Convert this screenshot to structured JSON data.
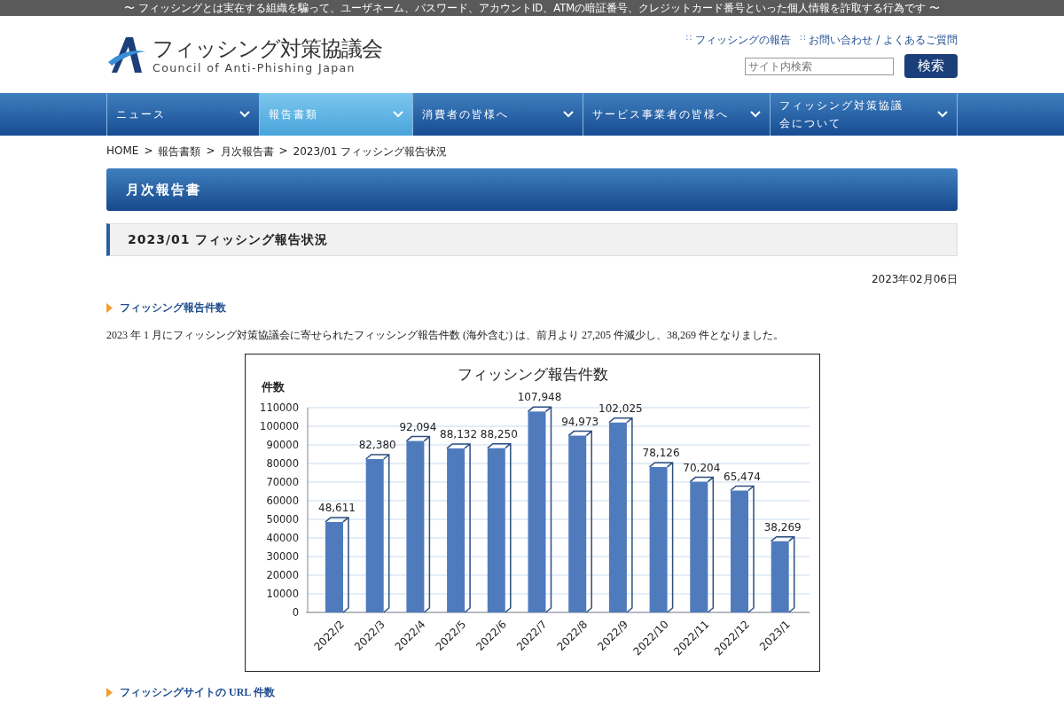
{
  "top_banner": "〜 フィッシングとは実在する組織を騙って、ユーザネーム、パスワード、アカウントID、ATMの暗証番号、クレジットカード番号といった個人情報を詐取する行為です 〜",
  "logo": {
    "title": "フィッシング対策協議会",
    "subtitle": "Council of Anti-Phishing Japan"
  },
  "header_links": [
    {
      "marker": "∷",
      "label": "フィッシングの報告"
    },
    {
      "marker": "∷",
      "label": "お問い合わせ / よくあるご質問"
    }
  ],
  "search": {
    "placeholder": "サイト内検索",
    "button": "検索"
  },
  "nav": [
    {
      "label": "ニュース",
      "selected": false
    },
    {
      "label": "報告書類",
      "selected": true
    },
    {
      "label": "消費者の皆様へ",
      "selected": false
    },
    {
      "label": "サービス事業者の皆様へ",
      "selected": false
    },
    {
      "label": "フィッシング対策協議会について",
      "selected": false
    }
  ],
  "breadcrumb": [
    "HOME",
    "報告書類",
    "月次報告書",
    "2023/01 フィッシング報告状況"
  ],
  "breadcrumb_separator": ">",
  "page_title": "月次報告書",
  "article_title": "2023/01 フィッシング報告状況",
  "date": "2023年02月06日",
  "sections": [
    {
      "heading": "フィッシング報告件数",
      "text": "2023 年 1 月にフィッシング対策協議会に寄せられたフィッシング報告件数 (海外含む) は、前月より 27,205 件減少し、38,269 件となりました。",
      "chart_data": {
        "type": "bar",
        "title": "フィッシング報告件数",
        "ylabel": "件数",
        "categories": [
          "2022/2",
          "2022/3",
          "2022/4",
          "2022/5",
          "2022/6",
          "2022/7",
          "2022/8",
          "2022/9",
          "2022/10",
          "2022/11",
          "2022/12",
          "2023/1"
        ],
        "values": [
          48611,
          82380,
          92094,
          88132,
          88250,
          107948,
          94973,
          102025,
          78126,
          70204,
          65474,
          38269
        ],
        "grid": true,
        "value_labels": [
          "48,611",
          "82,380",
          "92,094",
          "88,132",
          "88,250",
          "107,948",
          "94,973",
          "102,025",
          "78,126",
          "70,204",
          "65,474",
          "38,269"
        ],
        "ylim": [
          0,
          110000
        ],
        "yticks": [
          0,
          10000,
          20000,
          30000,
          40000,
          50000,
          60000,
          70000,
          80000,
          90000,
          100000,
          110000
        ]
      }
    },
    {
      "heading": "フィッシングサイトの URL 件数"
    }
  ]
}
